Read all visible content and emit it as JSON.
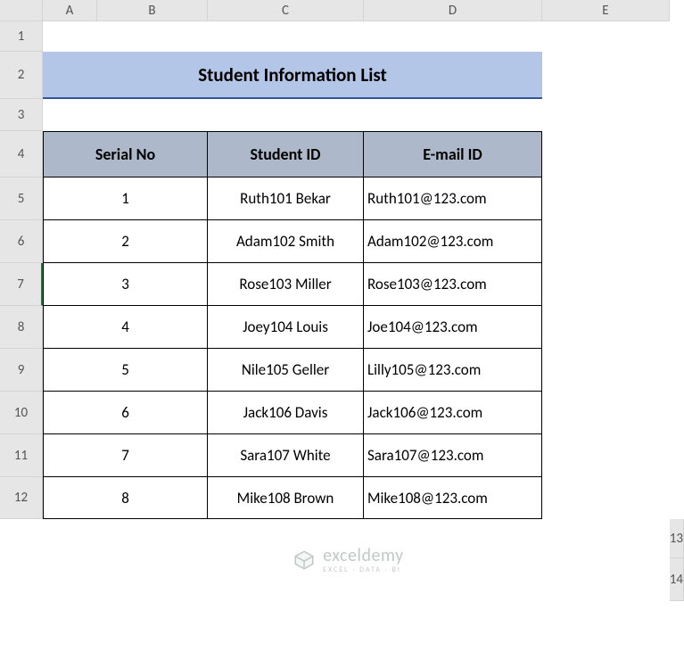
{
  "columns": [
    "A",
    "B",
    "C",
    "D",
    "E"
  ],
  "rows": [
    "1",
    "2",
    "3",
    "4",
    "5",
    "6",
    "7",
    "8",
    "9",
    "10",
    "11",
    "12",
    "13",
    "14"
  ],
  "title": "Student Information List",
  "headers": {
    "serial": "Serial No",
    "student_id": "Student ID",
    "email": "E-mail ID"
  },
  "data": [
    {
      "serial": "1",
      "student_id": "Ruth101 Bekar",
      "email": "Ruth101@123.com"
    },
    {
      "serial": "2",
      "student_id": "Adam102 Smith",
      "email": "Adam102@123.com"
    },
    {
      "serial": "3",
      "student_id": "Rose103 Miller",
      "email": "Rose103@123.com"
    },
    {
      "serial": "4",
      "student_id": "Joey104 Louis",
      "email": "Joe104@123.com"
    },
    {
      "serial": "5",
      "student_id": "Nile105 Geller",
      "email": "Lilly105@123.com"
    },
    {
      "serial": "6",
      "student_id": "Jack106 Davis",
      "email": "Jack106@123.com"
    },
    {
      "serial": "7",
      "student_id": "Sara107 White",
      "email": "Sara107@123.com"
    },
    {
      "serial": "8",
      "student_id": "Mike108 Brown",
      "email": "Mike108@123.com"
    }
  ],
  "watermark": {
    "brand": "exceldemy",
    "tag": "EXCEL · DATA · BI"
  },
  "colors": {
    "title_bg": "#b4c6e7",
    "title_border": "#2f5597",
    "header_bg": "#adb9ca",
    "grid_hdr_bg": "#e6e6e6"
  }
}
